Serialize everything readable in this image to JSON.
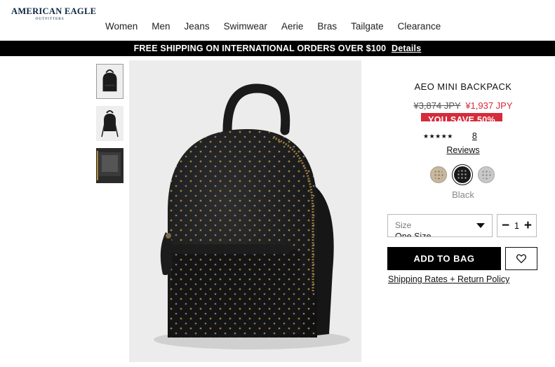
{
  "brand": {
    "name": "AMERICAN EAGLE",
    "sub": "OUTFITTERS"
  },
  "nav": {
    "items": [
      "Women",
      "Men",
      "Jeans",
      "Swimwear",
      "Aerie",
      "Bras",
      "Tailgate",
      "Clearance"
    ]
  },
  "promo": {
    "text": "FREE SHIPPING ON INTERNATIONAL ORDERS OVER $100",
    "link": "Details"
  },
  "product": {
    "title": "AEO MINI BACKPACK",
    "price_original": "¥3,874 JPY",
    "price_sale": "¥1,937 JPY",
    "savings": "YOU SAVE 50%",
    "stars": "★★★★★",
    "rating": 5,
    "review_count": "8",
    "reviews_label": "Reviews",
    "color": "Black",
    "swatches": [
      {
        "name": "tan",
        "hex": "#c8b8a0"
      },
      {
        "name": "black",
        "hex": "#1a1a1a",
        "selected": true
      },
      {
        "name": "silver",
        "hex": "#c9c9c9"
      }
    ]
  },
  "size_select": {
    "label": "Size",
    "value": "One Size"
  },
  "quantity": {
    "minus": "−",
    "value": "1",
    "plus": "+"
  },
  "actions": {
    "add_to_bag": "ADD TO BAG",
    "shipping": "Shipping Rates + Return Policy"
  },
  "icons": {
    "heart": "heart-icon",
    "caret": "chevron-down-icon"
  },
  "colors": {
    "promo_bg": "#000000",
    "sale_red": "#d52b3b",
    "brand_navy": "#0c2340"
  }
}
